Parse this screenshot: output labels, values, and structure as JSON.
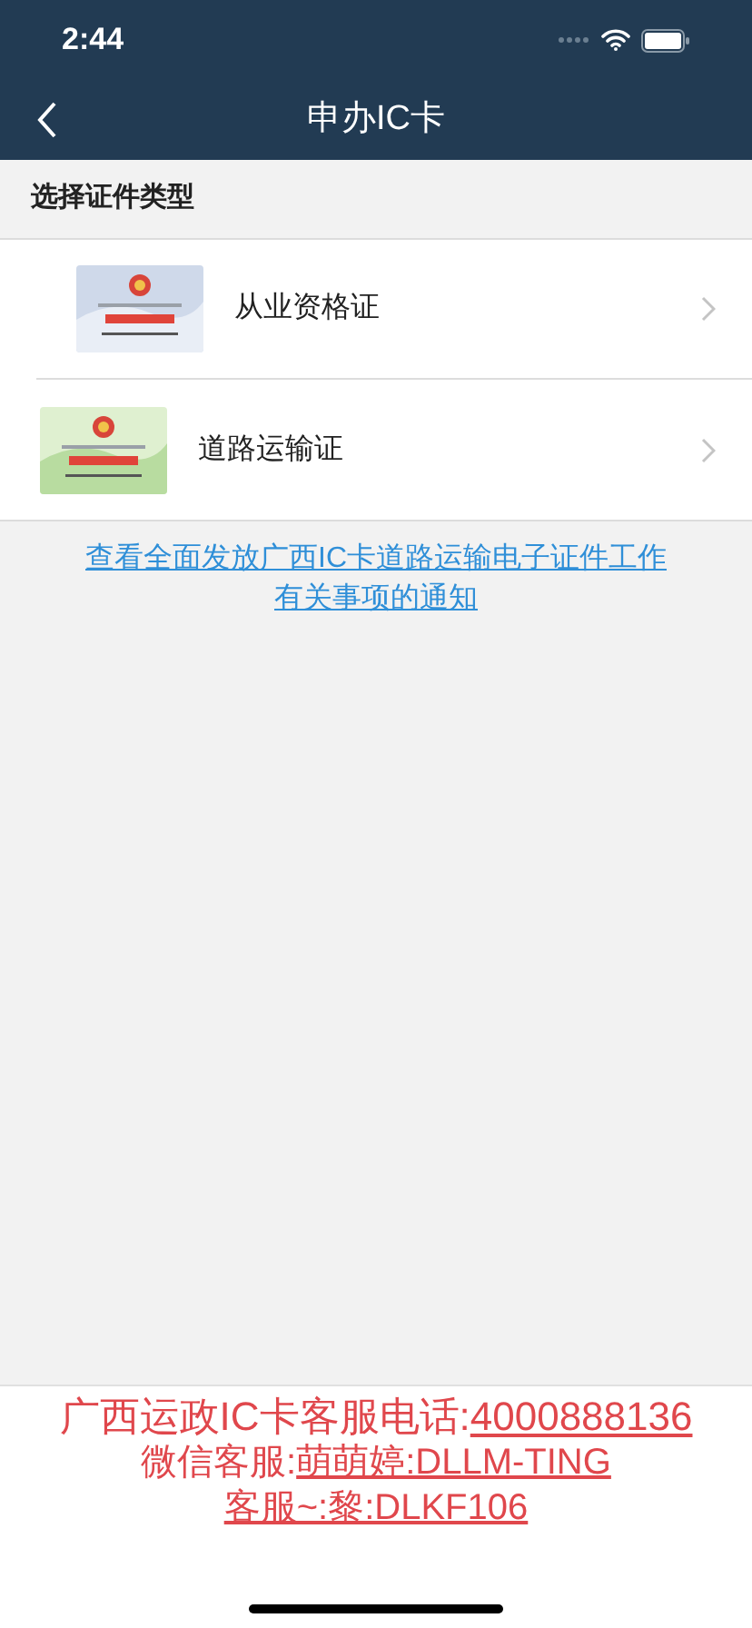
{
  "status_bar": {
    "time": "2:44"
  },
  "nav": {
    "title": "申办IC卡"
  },
  "section": {
    "title": "选择证件类型"
  },
  "items": [
    {
      "label": "从业资格证"
    },
    {
      "label": "道路运输证"
    }
  ],
  "notice_link": "查看全面发放广西IC卡道路运输电子证件工作有关事项的通知",
  "footer_lines": [
    {
      "label": "广西运政IC卡客服电话:",
      "link": "4000888136"
    },
    {
      "label": "微信客服:",
      "link": "萌萌婷:DLLM-TING"
    },
    {
      "link": "客服~:黎:DLKF106"
    }
  ]
}
